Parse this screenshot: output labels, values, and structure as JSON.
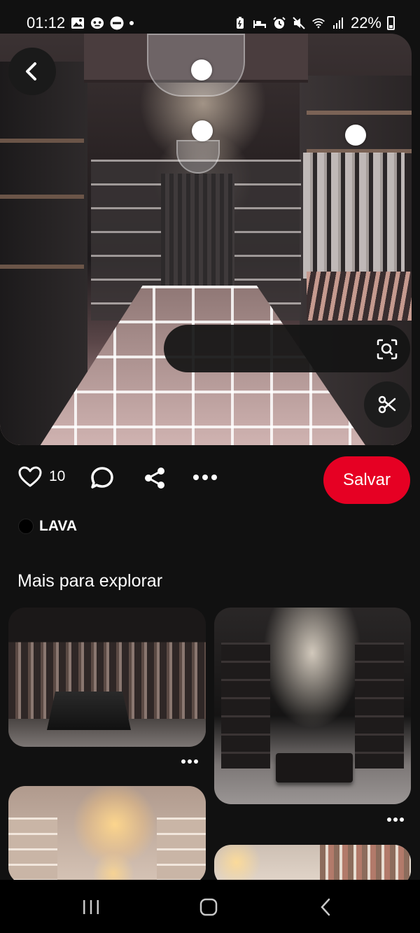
{
  "status_bar": {
    "time": "01:12",
    "battery_percent": "22%",
    "left_icons": [
      "gallery-icon",
      "messenger-icon",
      "do-not-disturb-icon",
      "notification-dot-icon"
    ],
    "right_icons": [
      "battery-saver-icon",
      "sleep-mode-icon",
      "alarm-icon",
      "mute-icon",
      "wifi-icon",
      "signal-icon",
      "battery-icon"
    ]
  },
  "pin": {
    "like_count": "10",
    "save_label": "Salvar",
    "author_name": "LAVA"
  },
  "actions": {
    "icons": [
      "heart-icon",
      "comment-icon",
      "share-icon",
      "more-icon"
    ]
  },
  "related": {
    "title": "Mais para explorar"
  },
  "colors": {
    "save_button": "#e60023",
    "background": "#111111"
  }
}
